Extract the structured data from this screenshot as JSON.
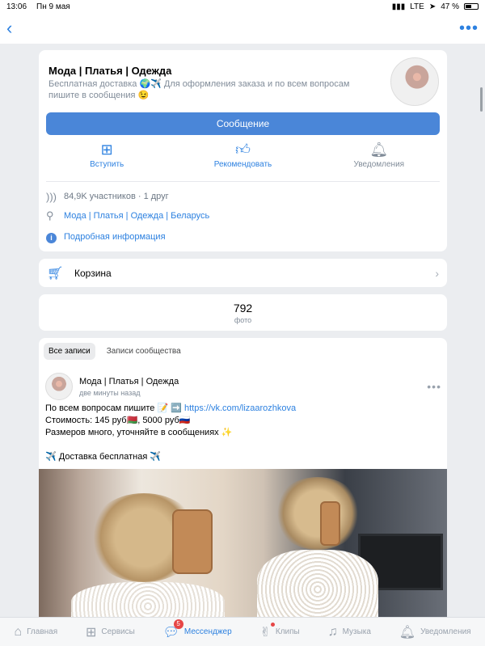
{
  "status_bar": {
    "time": "13:06",
    "date": "Пн 9 мая",
    "network": "LTE",
    "battery": "47 %"
  },
  "navbar": {
    "back_icon": "chevron-left-icon",
    "more_icon": "more-dots-icon"
  },
  "group": {
    "title": "Мода | Платья | Одежда",
    "subtitle": "Бесплатная доставка 🌍✈️ Для оформления заказа и по всем вопросам пишите в сообщения 😉",
    "message_button": "Сообщение",
    "actions": [
      {
        "label": "Вступить",
        "icon": "plus-square-icon"
      },
      {
        "label": "Рекомендовать",
        "icon": "thumbs-up-icon"
      },
      {
        "label": "Уведомления",
        "icon": "bell-icon"
      }
    ],
    "members": "84,9K участников · 1 друг",
    "location": "Мода | Платья | Одежда | Беларусь",
    "details": "Подробная информация"
  },
  "cart": {
    "label": "Корзина"
  },
  "photos": {
    "count": "792",
    "label": "фото"
  },
  "wall": {
    "tabs": [
      "Все записи",
      "Записи сообщества"
    ],
    "post": {
      "author": "Мода | Платья | Одежда",
      "time": "две минуты назад",
      "line1_text": "По всем вопросам пишите 📝 ➡️",
      "line1_link": "https://vk.com/lizaarozhkova",
      "line2": "Стоимость: 145 руб🇧🇾, 5000 руб🇷🇺",
      "line3": "Размеров много, уточняйте в сообщениях ✨",
      "line4": "✈️ Доставка бесплатная ✈️"
    }
  },
  "tabbar": {
    "items": [
      {
        "label": "Главная",
        "icon": "home-icon"
      },
      {
        "label": "Сервисы",
        "icon": "services-grid-icon"
      },
      {
        "label": "Мессенджер",
        "icon": "messenger-icon",
        "badge": "5"
      },
      {
        "label": "Клипы",
        "icon": "clips-icon"
      },
      {
        "label": "Музыка",
        "icon": "music-note-icon"
      },
      {
        "label": "Уведомления",
        "icon": "bell-icon"
      }
    ]
  }
}
